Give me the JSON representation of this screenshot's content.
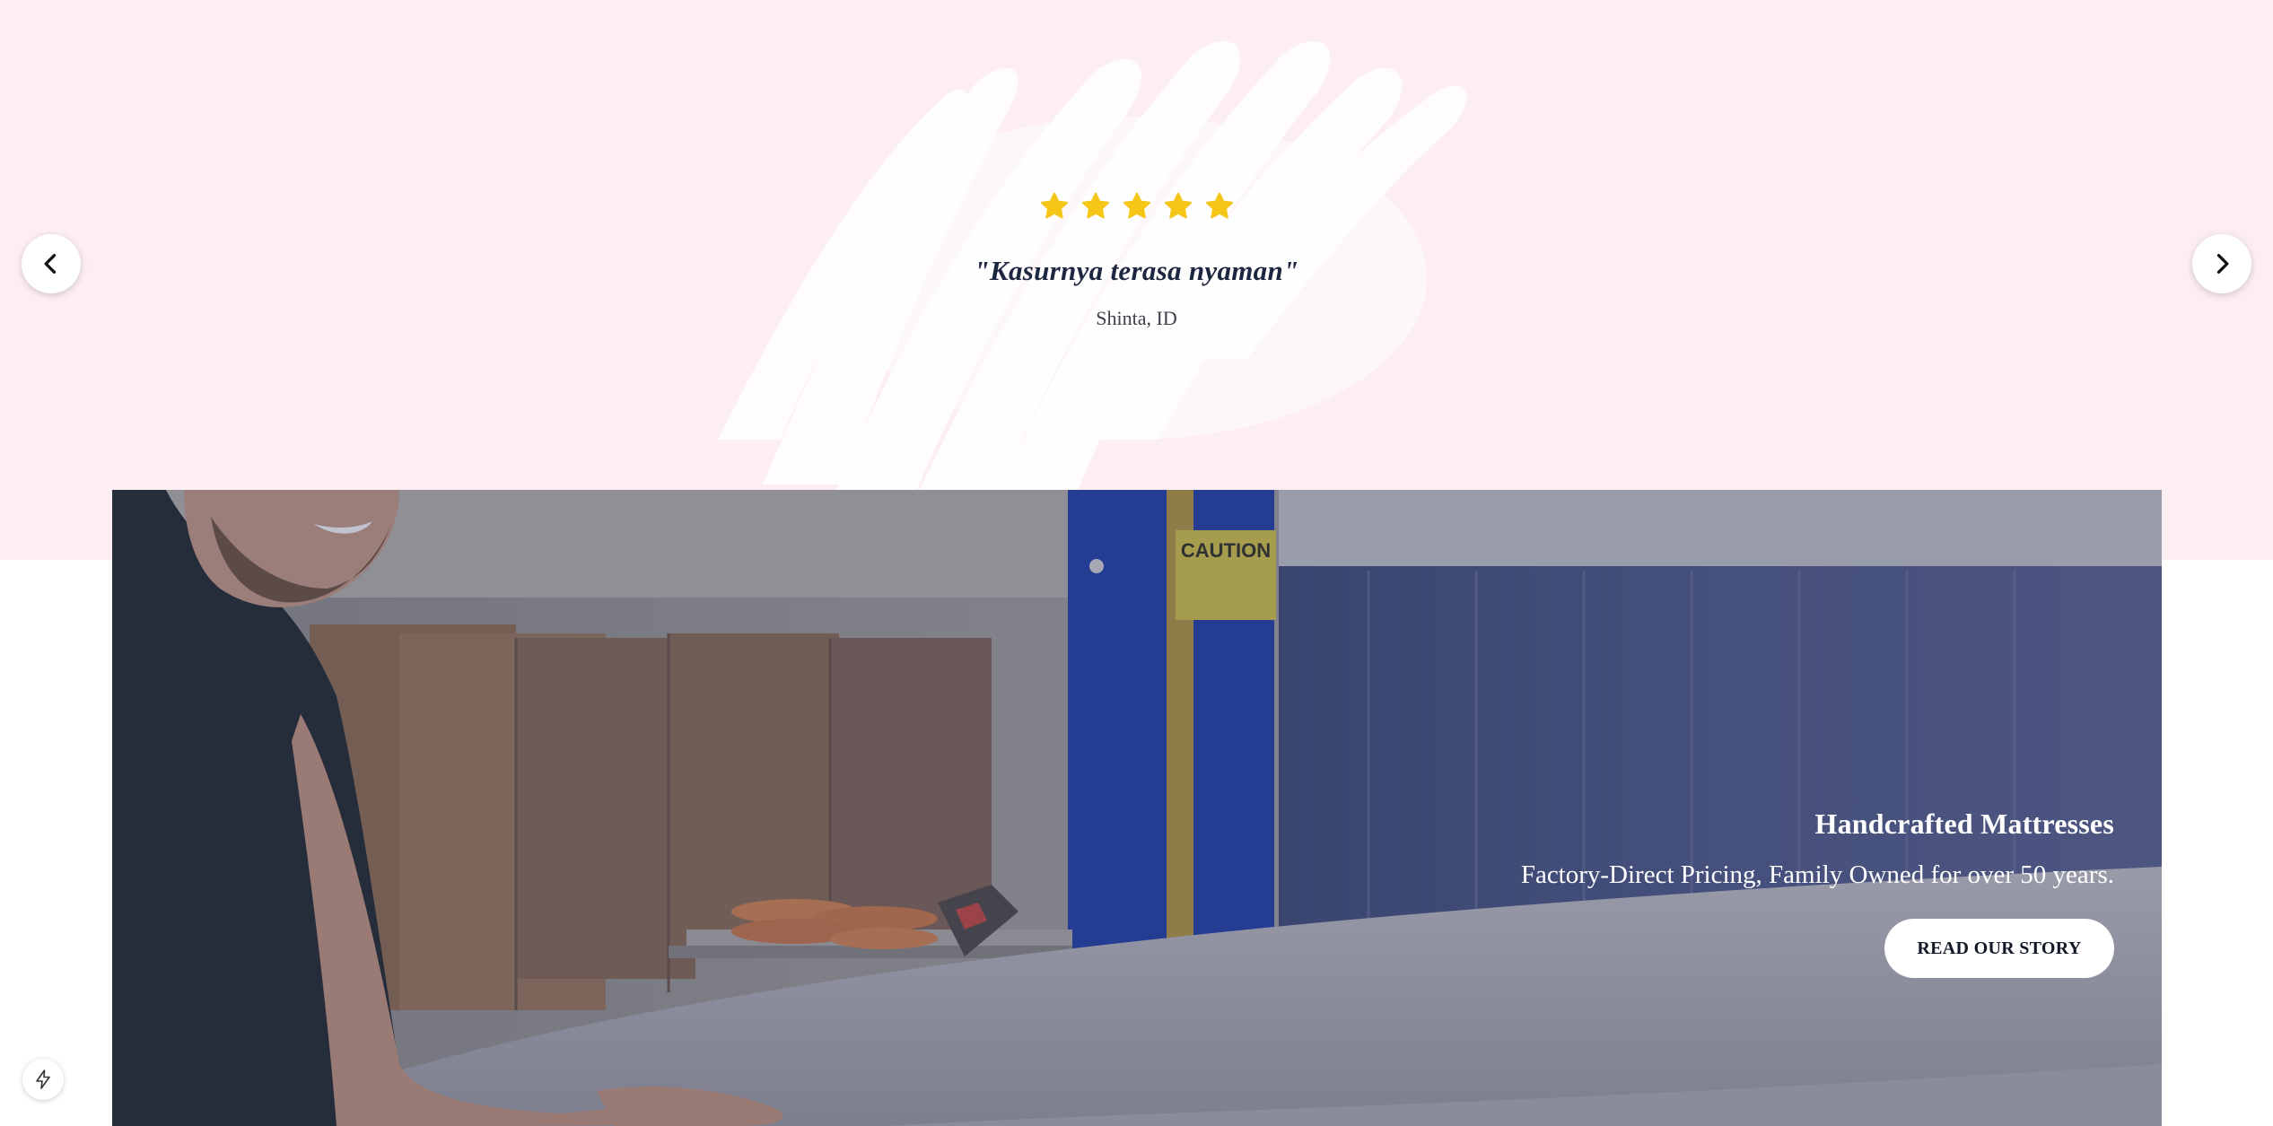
{
  "testimonial": {
    "rating": 5,
    "rating_max": 5,
    "quote": "\"Kasurnya terasa nyaman\"",
    "author": "Shinta, ID"
  },
  "carousel": {
    "prev_icon": "chevron-left-icon",
    "next_icon": "chevron-right-icon"
  },
  "hero": {
    "title": "Handcrafted Mattresses",
    "subtitle": "Factory-Direct Pricing, Family Owned for over 50 years.",
    "button_label": "READ OUR STORY",
    "sign_text": "CAUTION"
  },
  "utility": {
    "icon": "lightning-icon"
  },
  "colors": {
    "band_background": "#fdeef4",
    "star": "#f5c518",
    "quote_text": "#1c2640",
    "hero_text": "#ffffff",
    "button_background": "#ffffff"
  }
}
